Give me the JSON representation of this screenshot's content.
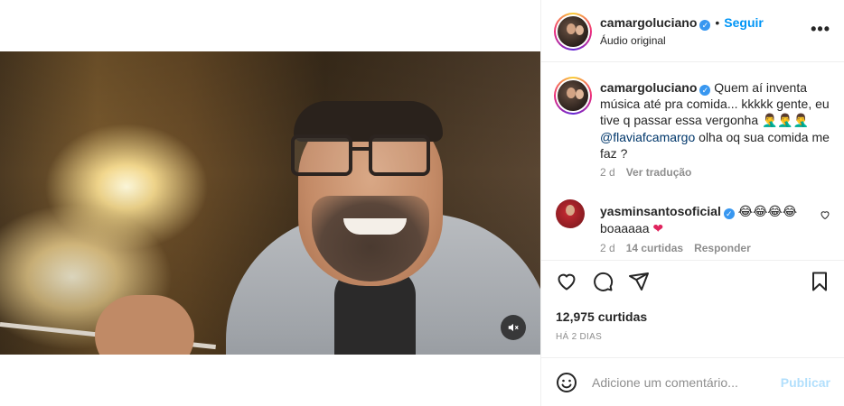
{
  "header": {
    "username": "camargoluciano",
    "follow_label": "Seguir",
    "dot": "•",
    "audio_label": "Áudio original",
    "more_icon": "more-horizontal-icon",
    "more_glyph": "•••"
  },
  "caption": {
    "username": "camargoluciano",
    "text_part1": "Quem aí inventa música até pra comida... kkkkk gente, eu tive q passar essa vergonha",
    "emoji_part1": "🤦‍♂️🤦‍♂️🤦‍♂️",
    "mention": "@flaviafcamargo",
    "text_part2": "olha oq sua comida me faz ?",
    "time": "2 d",
    "translate_label": "Ver tradução"
  },
  "comment": {
    "username": "yasminsantosoficial",
    "emojis": "😂😂😂😂",
    "text": "boaaaaa",
    "heart_emoji": "❤",
    "time": "2 d",
    "likes_label": "14 curtidas",
    "reply_label": "Responder"
  },
  "actions": {
    "like_icon": "heart-outline-icon",
    "comment_icon": "comment-bubble-icon",
    "share_icon": "paper-plane-icon",
    "save_icon": "bookmark-icon"
  },
  "post": {
    "likes": "12,975 curtidas",
    "date": "HÁ 2 DIAS"
  },
  "add_comment": {
    "placeholder": "Adicione um comentário...",
    "publish_label": "Publicar",
    "emoji_icon": "smiley-icon"
  },
  "video": {
    "muted_icon": "speaker-muted-icon"
  },
  "colors": {
    "accent": "#0095f6",
    "text": "#262626",
    "muted": "#8e8e8e",
    "publish_disabled": "#b2dffc",
    "verified": "#3897f0",
    "heart": "#e0245e"
  }
}
